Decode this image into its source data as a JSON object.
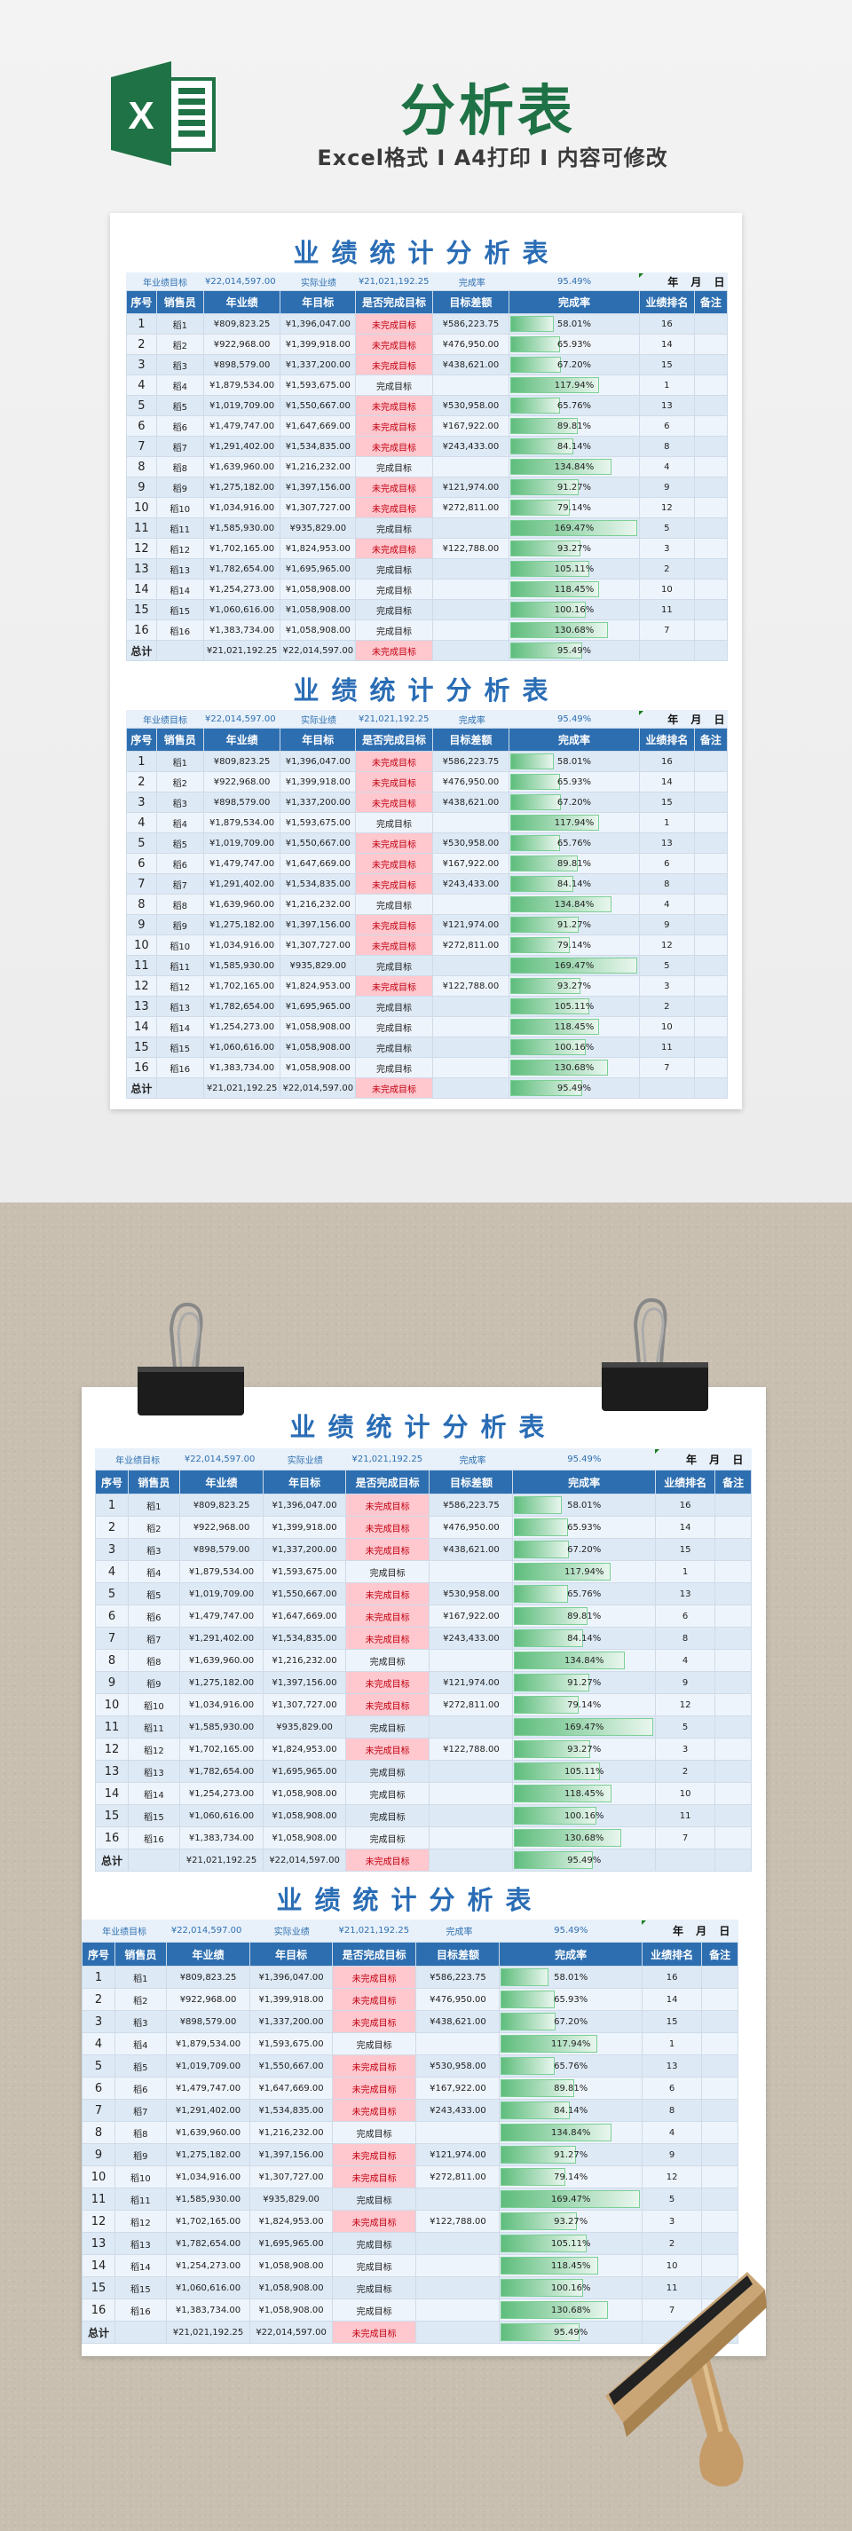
{
  "hero": {
    "title": "分析表",
    "subtitle": "Excel格式 I A4打印 I 内容可修改",
    "logo_icon": "excel-logo-icon",
    "brand_color": "#1f7245"
  },
  "table": {
    "title": "业绩统计分析表",
    "info": {
      "target_label": "年业绩目标",
      "target_value": "¥22,014,597.00",
      "actual_label": "实际业绩",
      "actual_value": "¥21,021,192.25",
      "rate_label": "完成率",
      "rate_value": "95.49%",
      "date_label": "年 月 日"
    },
    "headers": [
      "序号",
      "销售员",
      "年业绩",
      "年目标",
      "是否完成目标",
      "目标差额",
      "完成率",
      "业绩排名",
      "备注"
    ],
    "rows": [
      {
        "no": "1",
        "name": "稻1",
        "actual": "¥809,823.25",
        "target": "¥1,396,047.00",
        "status": "未完成目标",
        "gap": "¥586,223.75",
        "rate": "58.01%",
        "rate_pct": 58.01,
        "rank": "16",
        "note": ""
      },
      {
        "no": "2",
        "name": "稻2",
        "actual": "¥922,968.00",
        "target": "¥1,399,918.00",
        "status": "未完成目标",
        "gap": "¥476,950.00",
        "rate": "65.93%",
        "rate_pct": 65.93,
        "rank": "14",
        "note": ""
      },
      {
        "no": "3",
        "name": "稻3",
        "actual": "¥898,579.00",
        "target": "¥1,337,200.00",
        "status": "未完成目标",
        "gap": "¥438,621.00",
        "rate": "67.20%",
        "rate_pct": 67.2,
        "rank": "15",
        "note": ""
      },
      {
        "no": "4",
        "name": "稻4",
        "actual": "¥1,879,534.00",
        "target": "¥1,593,675.00",
        "status": "完成目标",
        "gap": "",
        "rate": "117.94%",
        "rate_pct": 117.94,
        "rank": "1",
        "note": ""
      },
      {
        "no": "5",
        "name": "稻5",
        "actual": "¥1,019,709.00",
        "target": "¥1,550,667.00",
        "status": "未完成目标",
        "gap": "¥530,958.00",
        "rate": "65.76%",
        "rate_pct": 65.76,
        "rank": "13",
        "note": ""
      },
      {
        "no": "6",
        "name": "稻6",
        "actual": "¥1,479,747.00",
        "target": "¥1,647,669.00",
        "status": "未完成目标",
        "gap": "¥167,922.00",
        "rate": "89.81%",
        "rate_pct": 89.81,
        "rank": "6",
        "note": ""
      },
      {
        "no": "7",
        "name": "稻7",
        "actual": "¥1,291,402.00",
        "target": "¥1,534,835.00",
        "status": "未完成目标",
        "gap": "¥243,433.00",
        "rate": "84.14%",
        "rate_pct": 84.14,
        "rank": "8",
        "note": ""
      },
      {
        "no": "8",
        "name": "稻8",
        "actual": "¥1,639,960.00",
        "target": "¥1,216,232.00",
        "status": "完成目标",
        "gap": "",
        "rate": "134.84%",
        "rate_pct": 134.84,
        "rank": "4",
        "note": ""
      },
      {
        "no": "9",
        "name": "稻9",
        "actual": "¥1,275,182.00",
        "target": "¥1,397,156.00",
        "status": "未完成目标",
        "gap": "¥121,974.00",
        "rate": "91.27%",
        "rate_pct": 91.27,
        "rank": "9",
        "note": ""
      },
      {
        "no": "10",
        "name": "稻10",
        "actual": "¥1,034,916.00",
        "target": "¥1,307,727.00",
        "status": "未完成目标",
        "gap": "¥272,811.00",
        "rate": "79.14%",
        "rate_pct": 79.14,
        "rank": "12",
        "note": ""
      },
      {
        "no": "11",
        "name": "稻11",
        "actual": "¥1,585,930.00",
        "target": "¥935,829.00",
        "status": "完成目标",
        "gap": "",
        "rate": "169.47%",
        "rate_pct": 169.47,
        "rank": "5",
        "note": ""
      },
      {
        "no": "12",
        "name": "稻12",
        "actual": "¥1,702,165.00",
        "target": "¥1,824,953.00",
        "status": "未完成目标",
        "gap": "¥122,788.00",
        "rate": "93.27%",
        "rate_pct": 93.27,
        "rank": "3",
        "note": ""
      },
      {
        "no": "13",
        "name": "稻13",
        "actual": "¥1,782,654.00",
        "target": "¥1,695,965.00",
        "status": "完成目标",
        "gap": "",
        "rate": "105.11%",
        "rate_pct": 105.11,
        "rank": "2",
        "note": ""
      },
      {
        "no": "14",
        "name": "稻14",
        "actual": "¥1,254,273.00",
        "target": "¥1,058,908.00",
        "status": "完成目标",
        "gap": "",
        "rate": "118.45%",
        "rate_pct": 118.45,
        "rank": "10",
        "note": ""
      },
      {
        "no": "15",
        "name": "稻15",
        "actual": "¥1,060,616.00",
        "target": "¥1,058,908.00",
        "status": "完成目标",
        "gap": "",
        "rate": "100.16%",
        "rate_pct": 100.16,
        "rank": "11",
        "note": ""
      },
      {
        "no": "16",
        "name": "稻16",
        "actual": "¥1,383,734.00",
        "target": "¥1,058,908.00",
        "status": "完成目标",
        "gap": "",
        "rate": "130.68%",
        "rate_pct": 130.68,
        "rank": "7",
        "note": ""
      }
    ],
    "total": {
      "label": "总计",
      "actual": "¥21,021,192.25",
      "target": "¥22,014,597.00",
      "status": "未完成目标",
      "gap": "",
      "rate": "95.49%",
      "rate_pct": 95.49,
      "rank": "",
      "note": ""
    },
    "colors": {
      "header": "#2d6eb0",
      "title": "#2a6db5",
      "fail_bg": "#ffc7ce",
      "fail_text": "#c00010",
      "bar": "#5ebd7c"
    }
  }
}
